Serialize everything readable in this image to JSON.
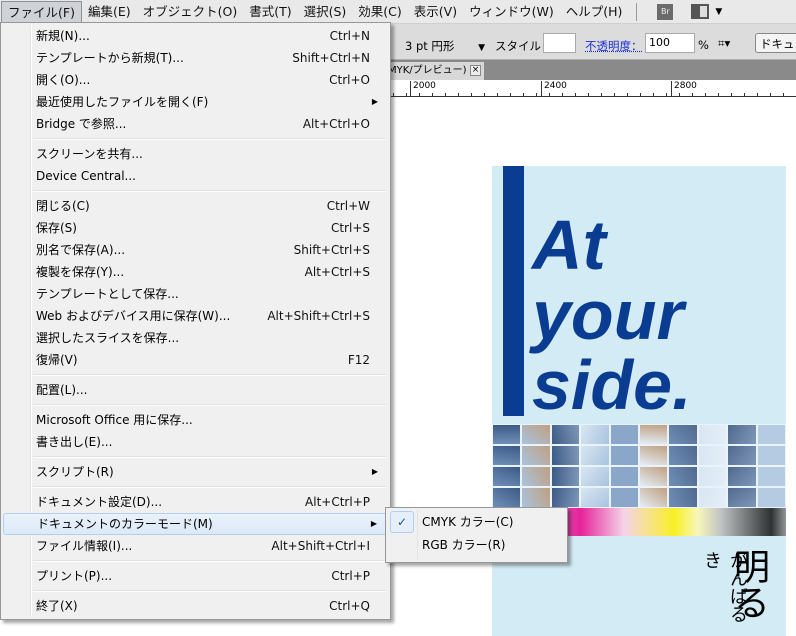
{
  "menubar": {
    "items": [
      "ファイル(F)",
      "編集(E)",
      "オブジェクト(O)",
      "書式(T)",
      "選択(S)",
      "効果(C)",
      "表示(V)",
      "ウィンドウ(W)",
      "ヘルプ(H)"
    ],
    "bridge_label": "Br"
  },
  "toolbar": {
    "stroke_profile": "3 pt 円形",
    "style_label": "スタイル：",
    "opacity_label": "不透明度：",
    "opacity_value": "100",
    "percent": "%",
    "document_button": "ドキュメ"
  },
  "doc_tab": {
    "title": "MYK/プレビュー)",
    "close": "×"
  },
  "ruler": {
    "labels": [
      "2000",
      "2400",
      "2800"
    ]
  },
  "artwork": {
    "line1": "At",
    "line2": "your",
    "line3": "side.",
    "jp_big": "明る",
    "jp_small": "がんばるき"
  },
  "file_menu": [
    [
      {
        "label": "新規(N)...",
        "shortcut": "Ctrl+N"
      },
      {
        "label": "テンプレートから新規(T)...",
        "shortcut": "Shift+Ctrl+N"
      },
      {
        "label": "開く(O)...",
        "shortcut": "Ctrl+O"
      },
      {
        "label": "最近使用したファイルを開く(F)",
        "shortcut": "",
        "submenu": true
      },
      {
        "label": "Bridge で参照...",
        "shortcut": "Alt+Ctrl+O"
      }
    ],
    [
      {
        "label": "スクリーンを共有...",
        "shortcut": ""
      },
      {
        "label": "Device Central...",
        "shortcut": ""
      }
    ],
    [
      {
        "label": "閉じる(C)",
        "shortcut": "Ctrl+W"
      },
      {
        "label": "保存(S)",
        "shortcut": "Ctrl+S"
      },
      {
        "label": "別名で保存(A)...",
        "shortcut": "Shift+Ctrl+S"
      },
      {
        "label": "複製を保存(Y)...",
        "shortcut": "Alt+Ctrl+S"
      },
      {
        "label": "テンプレートとして保存...",
        "shortcut": ""
      },
      {
        "label": "Web およびデバイス用に保存(W)...",
        "shortcut": "Alt+Shift+Ctrl+S"
      },
      {
        "label": "選択したスライスを保存...",
        "shortcut": ""
      },
      {
        "label": "復帰(V)",
        "shortcut": "F12"
      }
    ],
    [
      {
        "label": "配置(L)...",
        "shortcut": ""
      }
    ],
    [
      {
        "label": "Microsoft Office 用に保存...",
        "shortcut": ""
      },
      {
        "label": "書き出し(E)...",
        "shortcut": ""
      }
    ],
    [
      {
        "label": "スクリプト(R)",
        "shortcut": "",
        "submenu": true
      }
    ],
    [
      {
        "label": "ドキュメント設定(D)...",
        "shortcut": "Alt+Ctrl+P"
      },
      {
        "label": "ドキュメントのカラーモード(M)",
        "shortcut": "",
        "submenu": true,
        "highlighted": true
      },
      {
        "label": "ファイル情報(I)...",
        "shortcut": "Alt+Shift+Ctrl+I"
      }
    ],
    [
      {
        "label": "プリント(P)...",
        "shortcut": "Ctrl+P"
      }
    ],
    [
      {
        "label": "終了(X)",
        "shortcut": "Ctrl+Q"
      }
    ]
  ],
  "color_mode_submenu": [
    {
      "label": "CMYK カラー(C)",
      "checked": true,
      "check": "✓"
    },
    {
      "label": "RGB カラー(R)",
      "checked": false
    }
  ]
}
